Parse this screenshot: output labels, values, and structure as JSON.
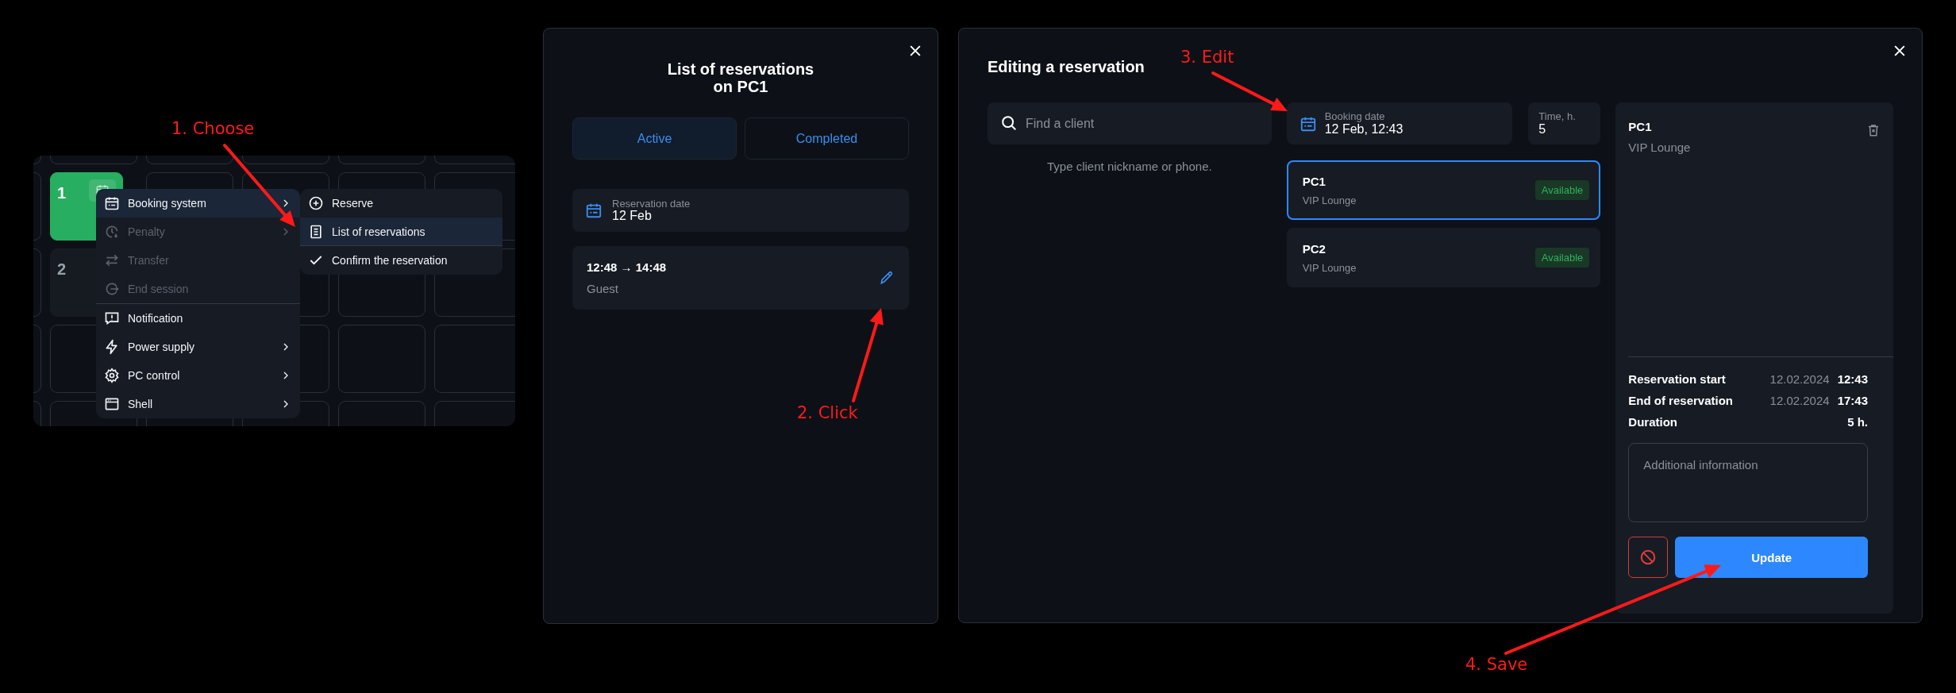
{
  "tile_grid": {
    "tiles": [
      {
        "number": "1",
        "color": "#27ae60"
      },
      {
        "number": "2",
        "color": "#161b22"
      }
    ]
  },
  "context_menu": {
    "groups": [
      {
        "items": [
          {
            "label": "Booking system",
            "selected": true,
            "disabled": false,
            "submenu": true
          },
          {
            "label": "Penalty",
            "selected": false,
            "disabled": true,
            "submenu": true
          },
          {
            "label": "Transfer",
            "selected": false,
            "disabled": true,
            "submenu": false
          },
          {
            "label": "End session",
            "selected": false,
            "disabled": true,
            "submenu": false
          }
        ]
      },
      {
        "items": [
          {
            "label": "Notification",
            "selected": false,
            "disabled": false,
            "submenu": false
          },
          {
            "label": "Power supply",
            "selected": false,
            "disabled": false,
            "submenu": true
          },
          {
            "label": "PC control",
            "selected": false,
            "disabled": false,
            "submenu": true
          },
          {
            "label": "Shell",
            "selected": false,
            "disabled": false,
            "submenu": true
          }
        ]
      }
    ]
  },
  "submenu": {
    "items": [
      {
        "label": "Reserve",
        "selected": false
      },
      {
        "label": "List of reservations",
        "selected": true
      },
      {
        "label": "Confirm the reservation",
        "selected": false
      }
    ]
  },
  "list_modal": {
    "title": "List of reservations\non PC1",
    "tabs": [
      {
        "label": "Active",
        "selected": true
      },
      {
        "label": "Completed",
        "selected": false
      }
    ],
    "date_field": {
      "label": "Reservation date",
      "value": "12 Feb"
    },
    "reservations": [
      {
        "time": "12:48 → 14:48",
        "client": "Guest"
      }
    ]
  },
  "edit_modal": {
    "title": "Editing a reservation",
    "search": {
      "placeholder": "Find a client"
    },
    "hint": "Type client nickname or phone.",
    "booking_date": {
      "label": "Booking date",
      "value": "12 Feb, 12:43"
    },
    "time": {
      "label": "Time, h.",
      "value": "5"
    },
    "pcs": [
      {
        "name": "PC1",
        "zone": "VIP Lounge",
        "badge": "Available",
        "selected": true
      },
      {
        "name": "PC2",
        "zone": "VIP Lounge",
        "badge": "Available",
        "selected": false
      }
    ],
    "details": {
      "name": "PC1",
      "zone": "VIP Lounge",
      "rows": [
        {
          "label": "Reservation start",
          "date": "12.02.2024",
          "time": "12:43"
        },
        {
          "label": "End of reservation",
          "date": "12.02.2024",
          "time": "17:43"
        },
        {
          "label": "Duration",
          "date": null,
          "time": "5 h."
        }
      ],
      "notes": {
        "placeholder": "Additional information"
      },
      "submit": "Update"
    }
  },
  "annotations": [
    {
      "label": "1. Choose"
    },
    {
      "label": "2. Click"
    },
    {
      "label": "3. Edit"
    },
    {
      "label": "4. Save"
    }
  ]
}
